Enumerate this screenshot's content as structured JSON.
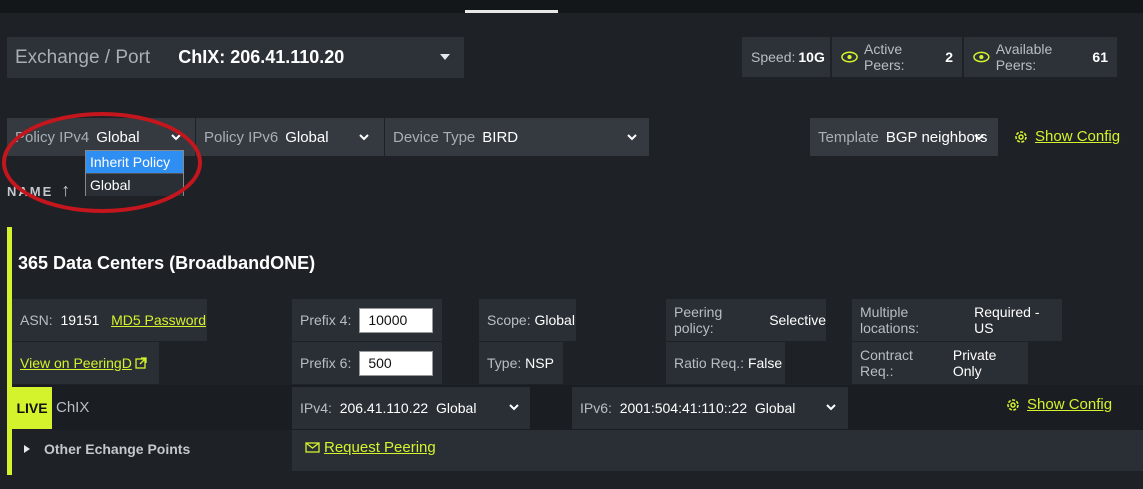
{
  "header": {
    "exchange_label": "Exchange / Port",
    "exchange_value": "ChIX: 206.41.110.20",
    "speed_label": "Speed:",
    "speed_value": "10G",
    "active_peers_label": "Active Peers:",
    "active_peers_value": "2",
    "available_peers_label": "Available Peers:",
    "available_peers_value": "61"
  },
  "filters": {
    "policy_ipv4_label": "Policy IPv4",
    "policy_ipv4_value": "Global",
    "policy_ipv4_options": [
      "Inherit Policy",
      "Global"
    ],
    "policy_ipv6_label": "Policy IPv6",
    "policy_ipv6_value": "Global",
    "device_type_label": "Device Type",
    "device_type_value": "BIRD",
    "template_label": "Template",
    "template_value": "BGP neighbors",
    "show_config": "Show Config"
  },
  "list": {
    "sort_header": "NAME",
    "sort_arrow": "↑"
  },
  "peer": {
    "name": "365 Data Centers (BroadbandONE)",
    "asn_label": "ASN:",
    "asn_value": "19151",
    "md5_link": "MD5 Password",
    "peeringdb_link": "View on PeeringD",
    "prefix4_label": "Prefix 4:",
    "prefix4_value": "10000",
    "prefix6_label": "Prefix 6:",
    "prefix6_value": "500",
    "scope_label": "Scope:",
    "scope_value": "Global",
    "type_label": "Type:",
    "type_value": "NSP",
    "peering_policy_label": "Peering policy:",
    "peering_policy_value": "Selective",
    "ratio_label": "Ratio Req.:",
    "ratio_value": "False",
    "multi_loc_label": "Multiple locations:",
    "multi_loc_value": "Required - US",
    "contract_label": "Contract Req.:",
    "contract_value": "Private Only",
    "live_badge": "LIVE",
    "exchange_name": "ChIX",
    "ipv4_label": "IPv4:",
    "ipv4_value": "206.41.110.22",
    "ipv4_policy": "Global",
    "ipv6_label": "IPv6:",
    "ipv6_value": "2001:504:41:110::22",
    "ipv6_policy": "Global",
    "show_config": "Show Config",
    "other_points": "Other Echange Points",
    "request_peering": "Request Peering"
  },
  "colors": {
    "accent": "#d4f32d",
    "annotation_circle": "#c4161c",
    "selected_option": "#2f8ef2"
  }
}
